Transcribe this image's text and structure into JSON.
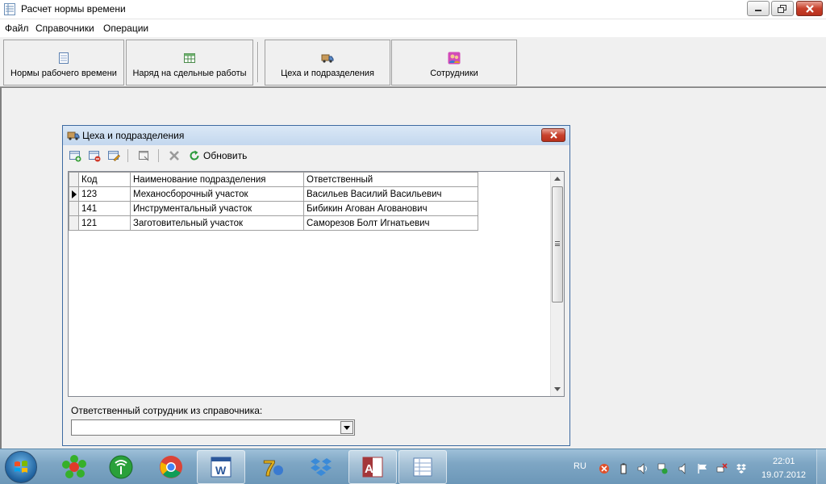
{
  "window": {
    "title": "Расчет нормы времени"
  },
  "menu": {
    "items": [
      "Файл",
      "Справочники",
      "Операции"
    ]
  },
  "toolbar": {
    "buttons": [
      {
        "label": "Нормы рабочего времени",
        "icon": "table-icon"
      },
      {
        "label": "Наряд на сдельные работы",
        "icon": "spreadsheet-icon"
      },
      {
        "label": "Цеха и подразделения",
        "icon": "truck-icon"
      },
      {
        "label": "Сотрудники",
        "icon": "users-icon"
      }
    ]
  },
  "child": {
    "title": "Цеха и подразделения",
    "refresh_label": "Обновить",
    "grid": {
      "columns": [
        "Код",
        "Наименование подразделения",
        "Ответственный"
      ],
      "rows": [
        [
          "123",
          "Механосборочный участок",
          "Васильев Василий Васильевич"
        ],
        [
          "141",
          "Инструментальный участок",
          "Бибикин Агован Агованович"
        ],
        [
          "121",
          "Заготовительный участок",
          "Саморезов Болт Игнатьевич"
        ]
      ],
      "selected_row": 0
    },
    "combo_label": "Ответственный сотрудник из справочника:",
    "combo_value": ""
  },
  "taskbar": {
    "language": "RU",
    "time": "22:01",
    "date": "19.07.2012",
    "apps": [
      "icq-icon",
      "antenna-icon",
      "chrome-icon",
      "word-icon",
      "seven-zip-icon",
      "dropbox-icon",
      "access-icon",
      "table-app-icon"
    ],
    "active_app": "access-icon"
  },
  "colors": {
    "accent": "#3d6aa1",
    "close": "#c8412c",
    "taskbar": "#7ea6c4"
  }
}
